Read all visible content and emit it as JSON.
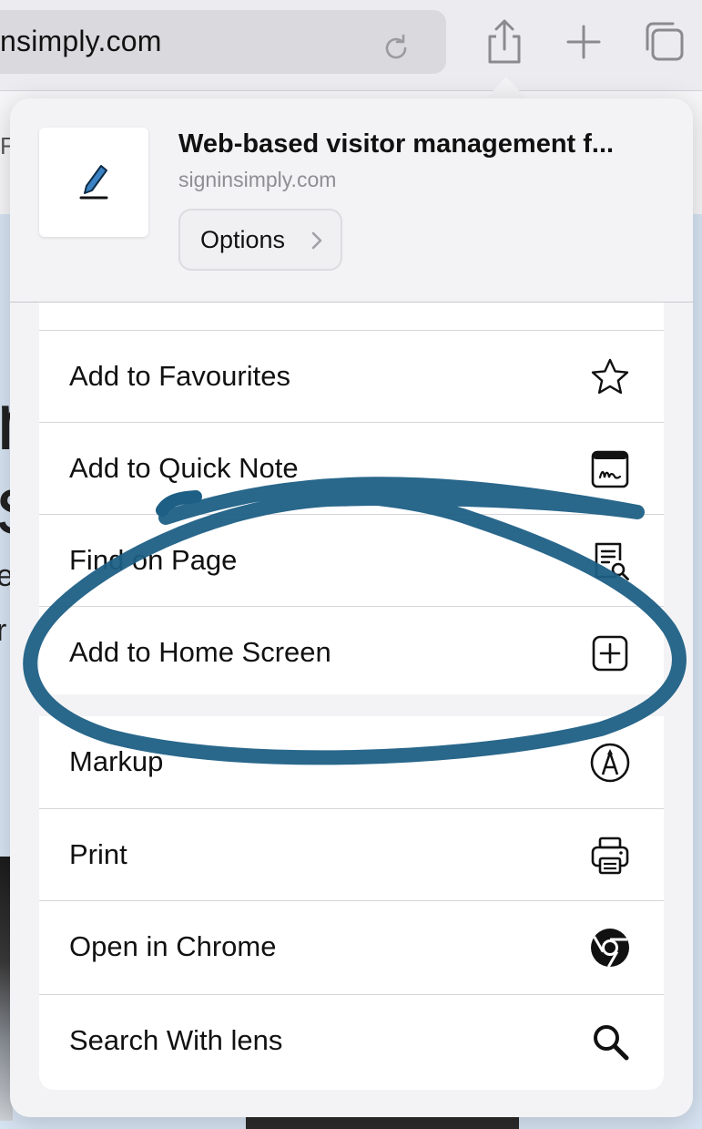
{
  "toolbar": {
    "address_text": "nsimply.com",
    "icons": [
      "reload-icon",
      "share-icon",
      "plus-icon",
      "tabs-icon"
    ]
  },
  "share_sheet": {
    "title": "Web-based visitor management f...",
    "domain": "signinsimply.com",
    "options_label": "Options",
    "actions": [
      {
        "label": "Add to Favourites",
        "icon": "star-icon"
      },
      {
        "label": "Add to Quick Note",
        "icon": "quick-note-icon"
      },
      {
        "label": "Find on Page",
        "icon": "find-on-page-icon"
      },
      {
        "label": "Add to Home Screen",
        "icon": "add-square-icon"
      },
      {
        "label": "Markup",
        "icon": "markup-icon"
      },
      {
        "label": "Print",
        "icon": "printer-icon"
      },
      {
        "label": "Open in Chrome",
        "icon": "chrome-icon"
      },
      {
        "label": "Search With lens",
        "icon": "magnifier-icon"
      }
    ]
  },
  "background_page": {
    "letters": [
      "F",
      "n",
      "s",
      "e",
      "r"
    ]
  },
  "colors": {
    "scribble": "#1e5f85",
    "sheet_bg": "#f3f3f5",
    "page_blue": "#d7e4f3"
  }
}
